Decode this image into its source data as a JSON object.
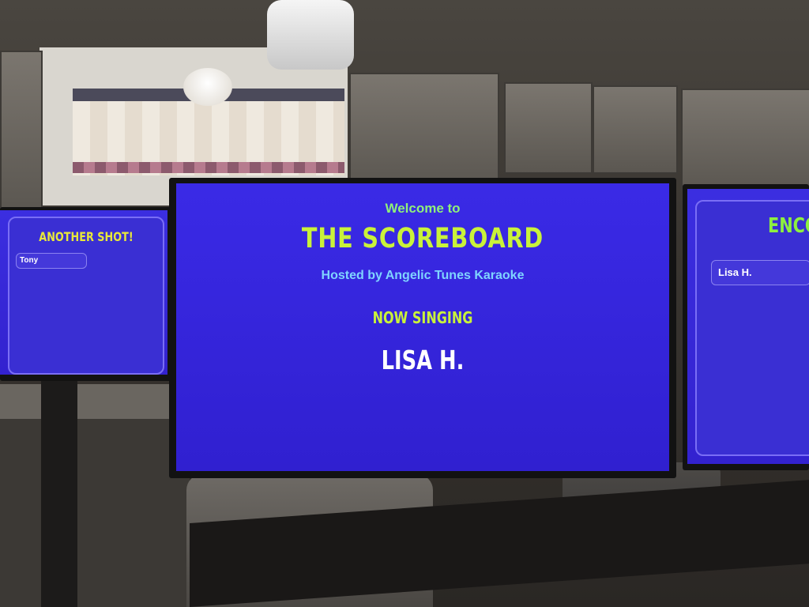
{
  "scene": "photo of karaoke scoreboard displays in a room",
  "main_screen": {
    "welcome": "Welcome to",
    "title": "THE SCOREBOARD",
    "hosted": "Hosted by Angelic Tunes Karaoke",
    "now_label": "NOW SINGING",
    "singer": "LISA H."
  },
  "left_screen": {
    "heading": "ANOTHER SHOT!",
    "names": [
      "Tony"
    ]
  },
  "right_screen": {
    "heading": "ENCO",
    "names": [
      "Lisa H."
    ]
  },
  "colors": {
    "screen_bg": "#3322cf",
    "title_yellow": "#c9f23a",
    "welcome_green": "#8ff07a",
    "hosted_blue": "#7fd4ff"
  }
}
